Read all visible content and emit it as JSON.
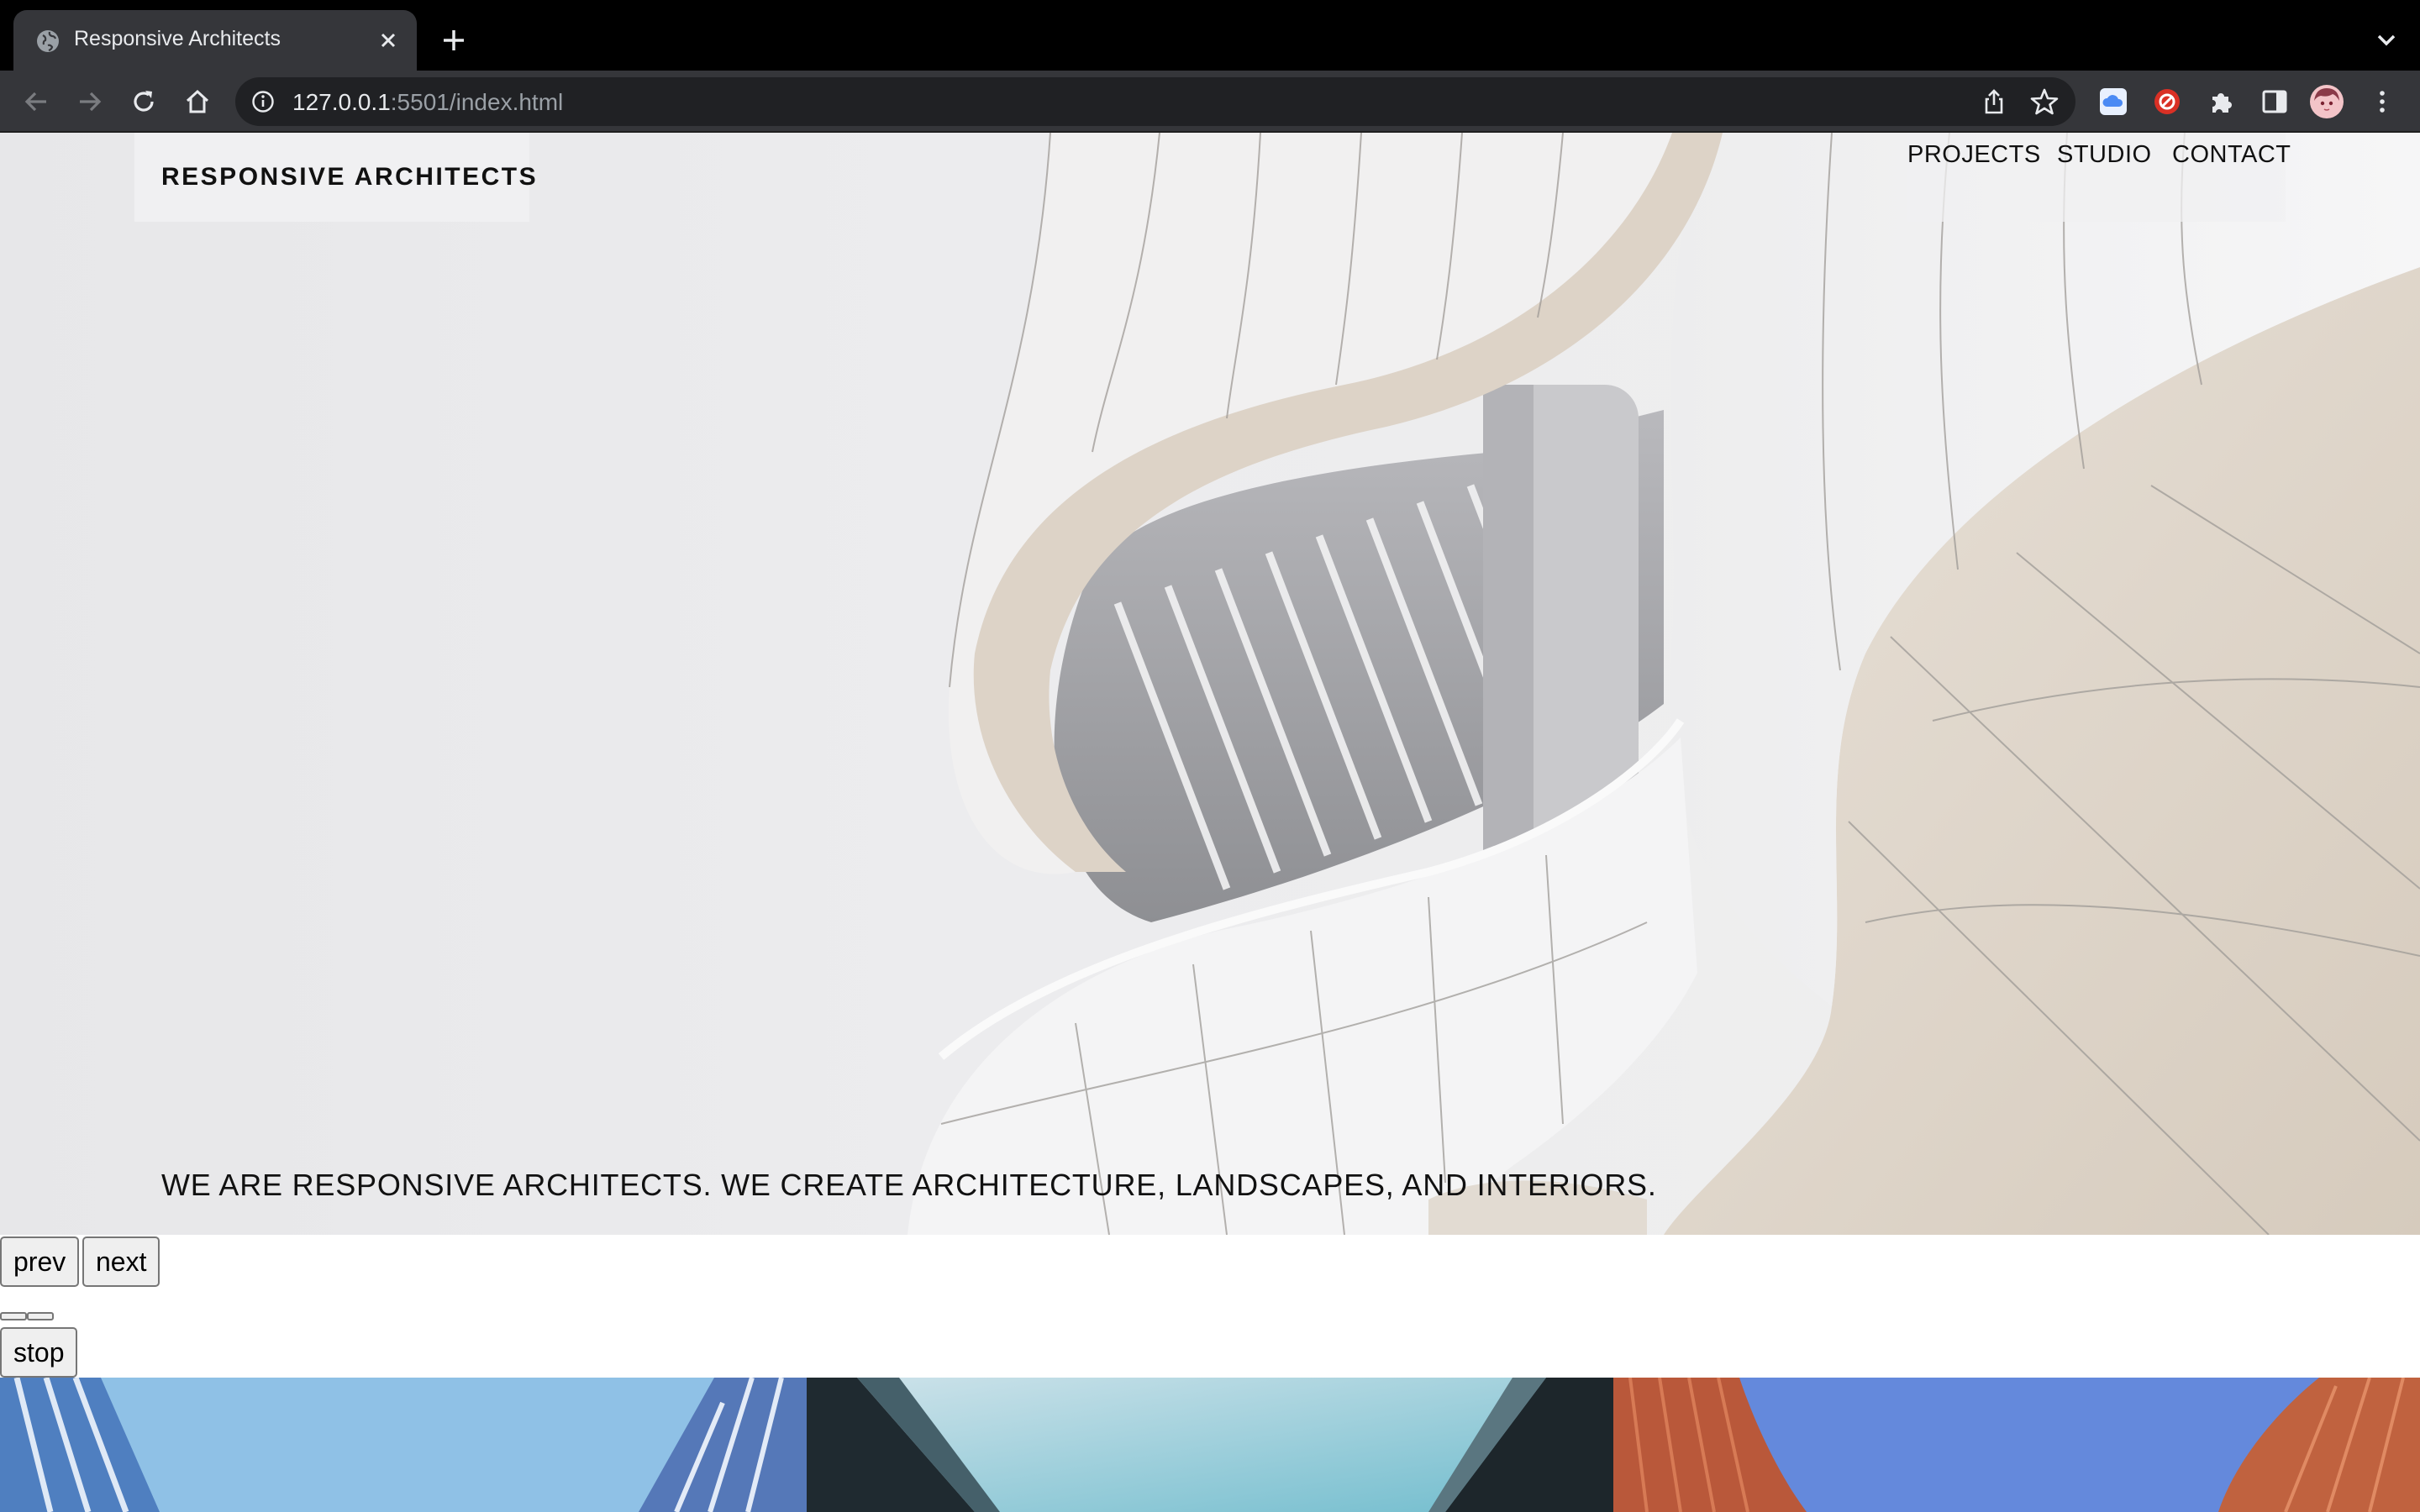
{
  "browser": {
    "tab_title": "Responsive Architects",
    "url_host": "127.0.0.1",
    "url_rest": ":5501/index.html"
  },
  "icons": [
    "globe-icon",
    "close-icon",
    "plus-icon",
    "chevron-down-icon",
    "back-arrow-icon",
    "forward-arrow-icon",
    "reload-icon",
    "home-icon",
    "info-icon",
    "share-icon",
    "star-icon",
    "cloud-extension-icon",
    "red-extension-icon",
    "puzzle-icon",
    "sidebar-icon",
    "avatar",
    "kebab-menu-icon"
  ],
  "site": {
    "brand": "RESPONSIVE ARCHITECTS",
    "nav": [
      "PROJECTS",
      "STUDIO",
      "CONTACT"
    ],
    "tagline": "WE ARE RESPONSIVE ARCHITECTS. WE CREATE ARCHITECTURE, LANDSCAPES, AND INTERIORS."
  },
  "slider": {
    "prev": "prev",
    "next": "next",
    "stop": "stop"
  },
  "colors": {
    "chrome_bg": "#000000",
    "toolbar_bg": "#35363a",
    "omnibox_bg": "#202124"
  }
}
